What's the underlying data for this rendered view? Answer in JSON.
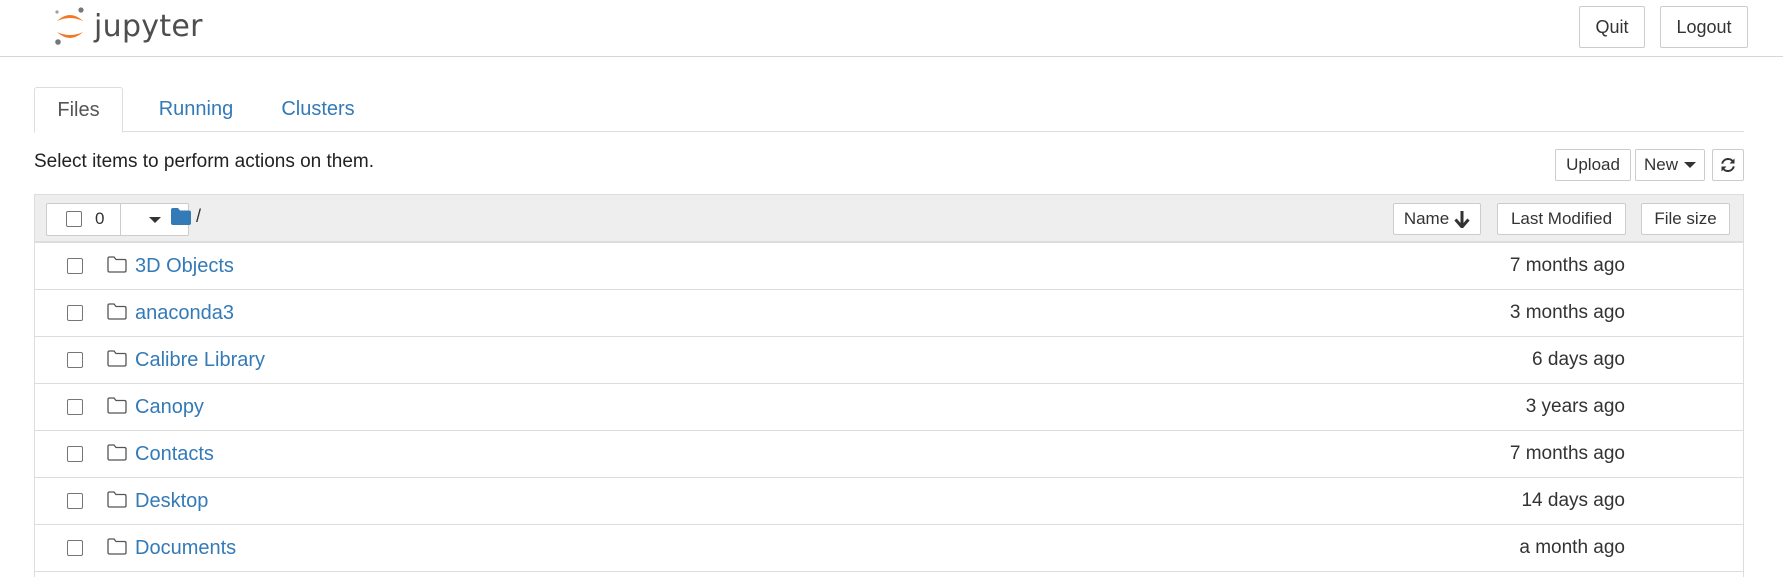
{
  "header": {
    "logo_text": "jupyter",
    "quit_label": "Quit",
    "logout_label": "Logout"
  },
  "tabs": [
    {
      "label": "Files",
      "active": true
    },
    {
      "label": "Running",
      "active": false
    },
    {
      "label": "Clusters",
      "active": false
    }
  ],
  "toolbar": {
    "hint": "Select items to perform actions on them.",
    "upload_label": "Upload",
    "new_label": "New",
    "refresh_icon": "refresh-icon"
  },
  "list_header": {
    "selected_count": "0",
    "path": "/",
    "name_label": "Name",
    "sort_icon": "arrow-down-icon",
    "last_modified_label": "Last Modified",
    "file_size_label": "File size"
  },
  "items": [
    {
      "name": "3D Objects",
      "modified": "7 months ago",
      "type": "folder"
    },
    {
      "name": "anaconda3",
      "modified": "3 months ago",
      "type": "folder"
    },
    {
      "name": "Calibre Library",
      "modified": "6 days ago",
      "type": "folder"
    },
    {
      "name": "Canopy",
      "modified": "3 years ago",
      "type": "folder"
    },
    {
      "name": "Contacts",
      "modified": "7 months ago",
      "type": "folder"
    },
    {
      "name": "Desktop",
      "modified": "14 days ago",
      "type": "folder"
    },
    {
      "name": "Documents",
      "modified": "a month ago",
      "type": "folder"
    }
  ],
  "colors": {
    "link": "#337ab7",
    "logo_orange": "#f37726",
    "header_bg": "#eeeeee"
  }
}
